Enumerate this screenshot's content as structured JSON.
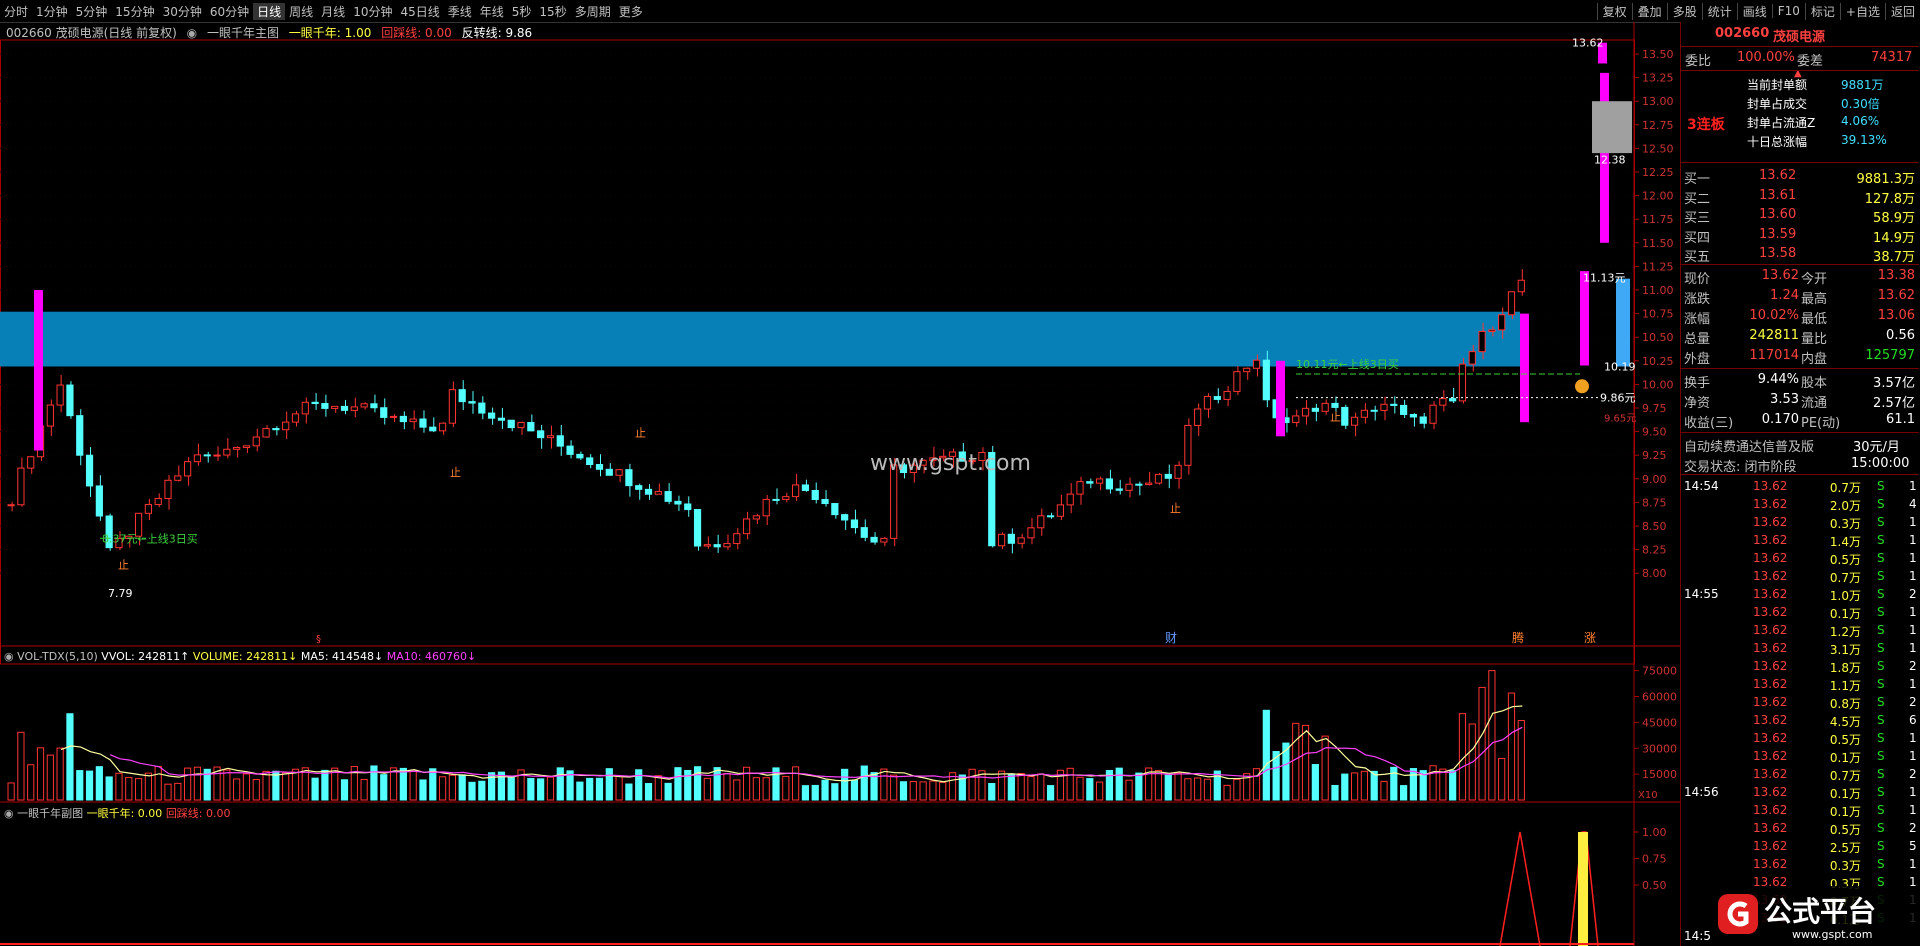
{
  "periods": [
    "分时",
    "1分钟",
    "5分钟",
    "15分钟",
    "30分钟",
    "60分钟",
    "日线",
    "周线",
    "月线",
    "10分钟",
    "45日线",
    "季线",
    "年线",
    "5秒",
    "15秒",
    "多周期",
    "更多"
  ],
  "active_period": "日线",
  "tools": [
    "复权",
    "叠加",
    "多股",
    "统计",
    "画线",
    "F10",
    "标记",
    "+自选",
    "返回"
  ],
  "info": {
    "stock": "002660 茂硕电源(日线 前复权)",
    "indicator": "一眼千年主图",
    "k1": "一眼千年: 1.00",
    "k2": "回踩线: 0.00",
    "k3": "反转线: 9.86"
  },
  "price_axis": [
    "13.50",
    "13.25",
    "13.00",
    "12.75",
    "12.50",
    "12.25",
    "12.00",
    "11.75",
    "11.50",
    "11.25",
    "11.00",
    "10.75",
    "10.50",
    "10.25",
    "10.00",
    "9.75",
    "9.50",
    "9.25",
    "9.00",
    "8.75",
    "8.50",
    "8.25",
    "8.00"
  ],
  "annotations": {
    "high": "13.62",
    "mid": "12.38",
    "yuan1": "11.13元",
    "band_low": "10.19",
    "buy_signal": "10.11元←上线3日买",
    "buy_signal2": "8.37元←上线3日买",
    "reverse": "9.86元",
    "low_label": "9.65元",
    "low": "7.79",
    "stop": "止",
    "cai": "财",
    "teng": "腾",
    "zhang": "涨",
    "watermark": "www.gspt.com"
  },
  "vol_header": {
    "name": "VOL-TDX(5,10)",
    "vvol": "VVOL: 242811↑",
    "volume": "VOLUME: 242811↓",
    "ma5": "MA5: 414548↓",
    "ma10": "MA10: 460760↓"
  },
  "vol_axis": [
    "75000",
    "60000",
    "45000",
    "30000",
    "15000"
  ],
  "vol_unit": "X10",
  "sub_header": {
    "name": "一眼千年副图",
    "k1": "一眼千年: 0.00",
    "k2": "回踩线: 0.00"
  },
  "sub_axis": [
    "1.00",
    "0.75",
    "0.50"
  ],
  "quote": {
    "code": "002660",
    "name": "茂硕电源",
    "weibi_label": "委比",
    "weibi": "100.00%",
    "weicha_label": "委差",
    "weicha": "74317",
    "lianban": "3连板",
    "seal": [
      {
        "label": "当前封单额",
        "value": "9881万"
      },
      {
        "label": "封单占成交",
        "value": "0.30倍"
      },
      {
        "label": "封单占流通Z",
        "value": "4.06%"
      },
      {
        "label": "十日总涨幅",
        "value": "39.13%"
      }
    ],
    "bids": [
      {
        "label": "买一",
        "price": "13.62",
        "vol": "9881.3万"
      },
      {
        "label": "买二",
        "price": "13.61",
        "vol": "127.8万"
      },
      {
        "label": "买三",
        "price": "13.60",
        "vol": "58.9万"
      },
      {
        "label": "买四",
        "price": "13.59",
        "vol": "14.9万"
      },
      {
        "label": "买五",
        "price": "13.58",
        "vol": "38.7万"
      }
    ],
    "stats": [
      {
        "l1": "现价",
        "v1": "13.62",
        "l2": "今开",
        "v2": "13.38"
      },
      {
        "l1": "涨跌",
        "v1": "1.24",
        "l2": "最高",
        "v2": "13.62"
      },
      {
        "l1": "涨幅",
        "v1": "10.02%",
        "l2": "最低",
        "v2": "13.06"
      },
      {
        "l1": "总量",
        "v1": "242811",
        "l2": "量比",
        "v2": "0.56"
      },
      {
        "l1": "外盘",
        "v1": "117014",
        "l2": "内盘",
        "v2": "125797"
      }
    ],
    "fund": [
      {
        "l1": "换手",
        "v1": "9.44%",
        "l2": "股本",
        "v2": "3.57亿"
      },
      {
        "l1": "净资",
        "v1": "3.53",
        "l2": "流通",
        "v2": "2.57亿"
      },
      {
        "l1": "收益(三)",
        "v1": "0.170",
        "l2": "PE(动)",
        "v2": "61.1"
      }
    ],
    "promo": "自动续费通达信普及版",
    "promo_price": "30元/月",
    "status_label": "交易状态: 闭市阶段",
    "status_time": "15:00:00"
  },
  "ticks": [
    {
      "t": "14:54",
      "p": "13.62",
      "v": "0.7万",
      "s": "S",
      "n": "1"
    },
    {
      "t": "",
      "p": "13.62",
      "v": "2.0万",
      "s": "S",
      "n": "4"
    },
    {
      "t": "",
      "p": "13.62",
      "v": "0.3万",
      "s": "S",
      "n": "1"
    },
    {
      "t": "",
      "p": "13.62",
      "v": "1.4万",
      "s": "S",
      "n": "1"
    },
    {
      "t": "",
      "p": "13.62",
      "v": "0.5万",
      "s": "S",
      "n": "1"
    },
    {
      "t": "",
      "p": "13.62",
      "v": "0.7万",
      "s": "S",
      "n": "1"
    },
    {
      "t": "14:55",
      "p": "13.62",
      "v": "1.0万",
      "s": "S",
      "n": "2"
    },
    {
      "t": "",
      "p": "13.62",
      "v": "0.1万",
      "s": "S",
      "n": "1"
    },
    {
      "t": "",
      "p": "13.62",
      "v": "1.2万",
      "s": "S",
      "n": "1"
    },
    {
      "t": "",
      "p": "13.62",
      "v": "3.1万",
      "s": "S",
      "n": "1"
    },
    {
      "t": "",
      "p": "13.62",
      "v": "1.8万",
      "s": "S",
      "n": "2"
    },
    {
      "t": "",
      "p": "13.62",
      "v": "1.1万",
      "s": "S",
      "n": "1"
    },
    {
      "t": "",
      "p": "13.62",
      "v": "0.8万",
      "s": "S",
      "n": "2"
    },
    {
      "t": "",
      "p": "13.62",
      "v": "4.5万",
      "s": "S",
      "n": "6"
    },
    {
      "t": "",
      "p": "13.62",
      "v": "0.5万",
      "s": "S",
      "n": "1"
    },
    {
      "t": "",
      "p": "13.62",
      "v": "0.1万",
      "s": "S",
      "n": "1"
    },
    {
      "t": "",
      "p": "13.62",
      "v": "0.7万",
      "s": "S",
      "n": "2"
    },
    {
      "t": "14:56",
      "p": "13.62",
      "v": "0.1万",
      "s": "S",
      "n": "1"
    },
    {
      "t": "",
      "p": "13.62",
      "v": "0.1万",
      "s": "S",
      "n": "1"
    },
    {
      "t": "",
      "p": "13.62",
      "v": "0.5万",
      "s": "S",
      "n": "2"
    },
    {
      "t": "",
      "p": "13.62",
      "v": "2.5万",
      "s": "S",
      "n": "5"
    },
    {
      "t": "",
      "p": "13.62",
      "v": "0.3万",
      "s": "S",
      "n": "1"
    },
    {
      "t": "",
      "p": "13.62",
      "v": "0.3万",
      "s": "S",
      "n": "1"
    },
    {
      "t": "",
      "p": "13.62",
      "v": "0.7万",
      "s": "S",
      "n": "1"
    },
    {
      "t": "",
      "p": "13.62",
      "v": "0.1万",
      "s": "S",
      "n": "1"
    },
    {
      "t": "14:5",
      "p": "",
      "v": "",
      "s": "",
      "n": ""
    }
  ],
  "logo_text": "公式平台",
  "logo_url": "www.gspt.com",
  "colors": {
    "up": "#ff3333",
    "down": "#54ffff",
    "band": "#0780b8",
    "magenta": "#ff00ff",
    "border": "#aa0000"
  }
}
